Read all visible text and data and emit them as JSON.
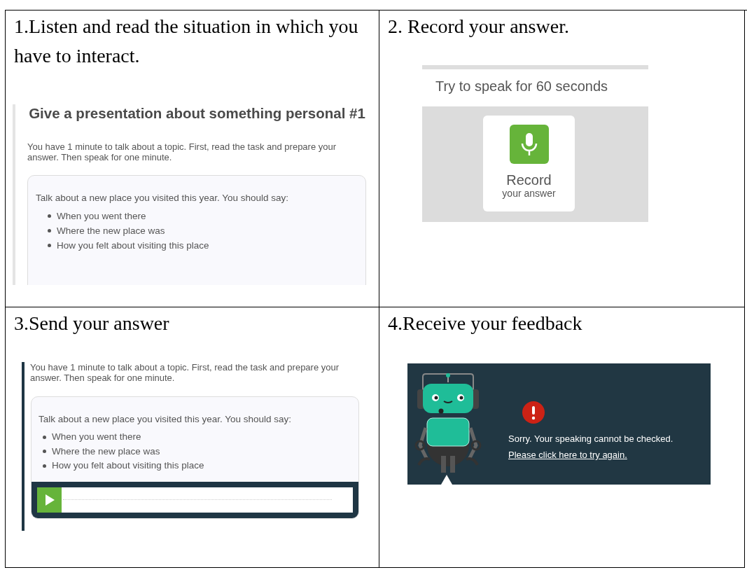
{
  "steps": [
    {
      "kind": "task",
      "heading": "1.Listen and read the situation in which you have to interact.",
      "panel": {
        "title": "Give a presentation about something personal #1",
        "intro": "You have 1 minute to talk about a topic. First, read the task and prepare your answer. Then speak for one minute.",
        "prompt": "Talk about a new place you visited this year. You should say:",
        "bullets": [
          "When you went there",
          "Where the new place was",
          "How you felt about visiting this place"
        ]
      }
    },
    {
      "kind": "record",
      "heading": "2. Record your answer.",
      "panel": {
        "hint": "Try to speak for 60 seconds",
        "button_label": "Record",
        "button_sublabel": "your answer"
      }
    },
    {
      "kind": "send",
      "heading": "3.Send your answer",
      "panel": {
        "intro": "You have 1 minute to talk about a topic. First, read the task and prepare your answer. Then speak for one minute.",
        "prompt": "Talk about a new place you visited this year. You should say:",
        "bullets": [
          "When you went there",
          "Where the new place was",
          "How you felt about visiting this place"
        ]
      }
    },
    {
      "kind": "feedback",
      "heading": "4.Receive your feedback",
      "panel": {
        "message": "Sorry. Your speaking cannot be checked.",
        "link": "Please click here to try again."
      }
    }
  ]
}
